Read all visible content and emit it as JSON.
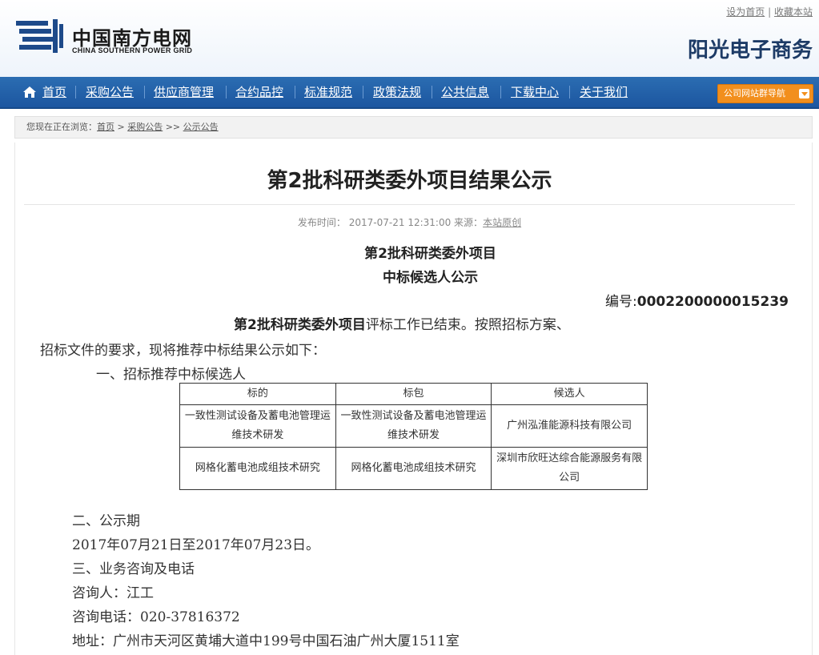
{
  "header": {
    "logo_cn": "中国南方电网",
    "logo_en": "CHINA SOUTHERN POWER GRID",
    "brand": "阳光电子商务",
    "top_links": {
      "set_home": "设为首页",
      "separator": "|",
      "bookmark": "收藏本站"
    }
  },
  "nav": {
    "items": [
      {
        "label": "首页",
        "icon": "home-icon"
      },
      {
        "label": "采购公告"
      },
      {
        "label": "供应商管理"
      },
      {
        "label": "合约品控"
      },
      {
        "label": "标准规范"
      },
      {
        "label": "政策法规"
      },
      {
        "label": "公共信息"
      },
      {
        "label": "下载中心"
      },
      {
        "label": "关于我们"
      }
    ],
    "dropdown_label": "公司网站群导航",
    "dropdown_icon": "chevron-down-icon",
    "dropdown_color": "#f28f1d",
    "bar_color": "#1f5aa6"
  },
  "breadcrumb": {
    "prefix": "您现在正在浏览：",
    "items": [
      "首页",
      "采购公告",
      "公示公告"
    ],
    "sep1": ">",
    "sep2": ">>"
  },
  "article": {
    "title": "第2批科研类委外项目结果公示",
    "meta": {
      "published_label": "发布时间：",
      "published": "2017-07-21 12:31:00",
      "source_label": "来源：",
      "source": "本站原创"
    },
    "subtitle1": "第2批科研类委外项目",
    "subtitle2": "中标候选人公示",
    "serial_label": "编号:",
    "serial": "0002200000015239",
    "intro_bold": "第2批科研类委外项目",
    "intro_line1_rest": "评标工作已结束。按照招标方案、",
    "intro_line2": "招标文件的要求，现将推荐中标结果公示如下：",
    "section1": "一、招标推荐中标候选人",
    "table": {
      "headers": [
        "标的",
        "标包",
        "候选人"
      ],
      "rows": [
        [
          "一致性测试设备及蓄电池管理运维技术研发",
          "一致性测试设备及蓄电池管理运维技术研发",
          "广州泓淮能源科技有限公司"
        ],
        [
          "网格化蓄电池成组技术研究",
          "网格化蓄电池成组技术研究",
          "深圳市欣旺达综合能源服务有限公司"
        ]
      ]
    },
    "section2": "二、公示期",
    "period": "2017年07月21日至2017年07月23日。",
    "section3": "三、业务咨询及电话",
    "contact": "咨询人：江工",
    "phone": "咨询电话：020-37816372",
    "address": "地址：广州市天河区黄埔大道中199号中国石油广州大厦1511室"
  }
}
